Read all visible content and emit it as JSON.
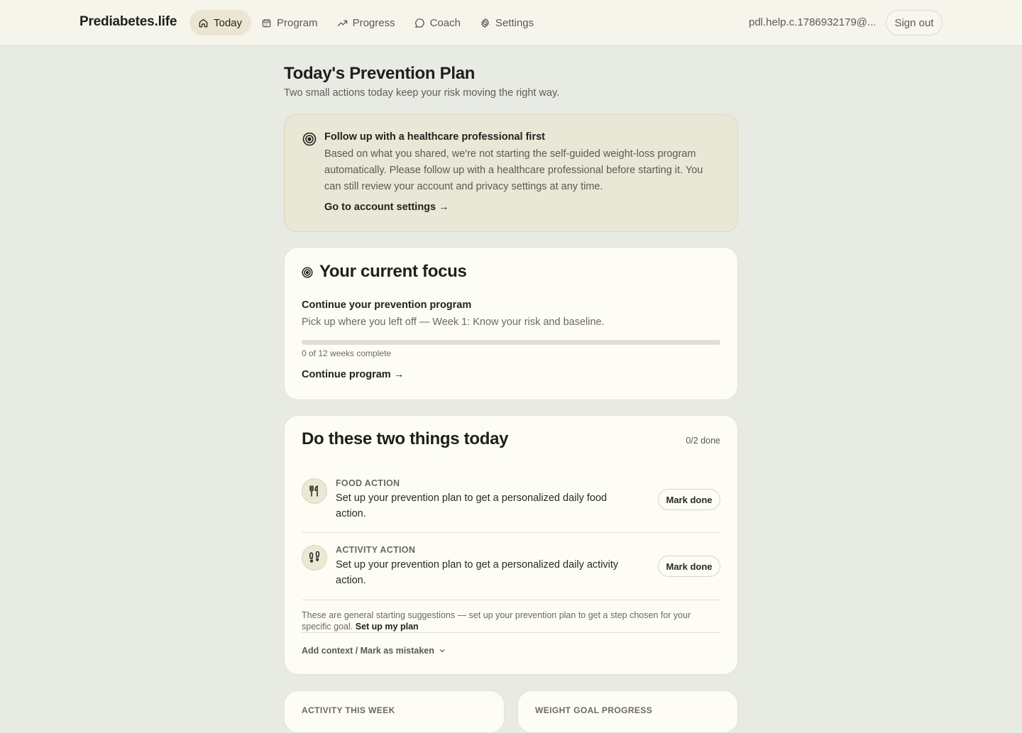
{
  "header": {
    "brand": "Prediabetes.life",
    "nav": [
      {
        "label": "Today",
        "icon": "home-icon",
        "active": true
      },
      {
        "label": "Program",
        "icon": "calendar-icon",
        "active": false
      },
      {
        "label": "Progress",
        "icon": "trend-icon",
        "active": false
      },
      {
        "label": "Coach",
        "icon": "chat-icon",
        "active": false
      },
      {
        "label": "Settings",
        "icon": "gear-icon",
        "active": false
      }
    ],
    "email": "pdl.help.c.1786932179@...",
    "sign_out": "Sign out"
  },
  "page": {
    "title": "Today's Prevention Plan",
    "subtitle": "Two small actions today keep your risk moving the right way."
  },
  "alert": {
    "title": "Follow up with a healthcare professional first",
    "body": "Based on what you shared, we're not starting the self-guided weight-loss program automatically. Please follow up with a healthcare professional before starting it. You can still review your account and privacy settings at any time.",
    "link": "Go to account settings →"
  },
  "focus": {
    "title": "Your current focus",
    "heading": "Continue your prevention program",
    "description": "Pick up where you left off — Week 1: Know your risk and baseline.",
    "progress_fraction": 0,
    "progress_text": "0 of 12 weeks complete",
    "link": "Continue program →"
  },
  "today": {
    "title": "Do these two things today",
    "done_count": "0/2 done",
    "actions": [
      {
        "kind": "FOOD ACTION",
        "icon": "utensils-icon",
        "text": "Set up your prevention plan to get a personalized daily food action.",
        "button": "Mark done"
      },
      {
        "kind": "ACTIVITY ACTION",
        "icon": "footprints-icon",
        "text": "Set up your prevention plan to get a personalized daily activity action.",
        "button": "Mark done"
      }
    ],
    "note": "These are general starting suggestions — set up your prevention plan to get a step chosen for your specific goal.",
    "note_link": "Set up my plan",
    "context_link": "Add context / Mark as mistaken"
  },
  "bottom_cards": {
    "left_label": "ACTIVITY THIS WEEK",
    "right_label": "WEIGHT GOAL PROGRESS"
  },
  "colors": {
    "background": "#e8eae4",
    "header": "#f6f5ec",
    "card": "#fdfcf5",
    "alert": "#e9e8d6",
    "accent": "#ebe6d2"
  }
}
